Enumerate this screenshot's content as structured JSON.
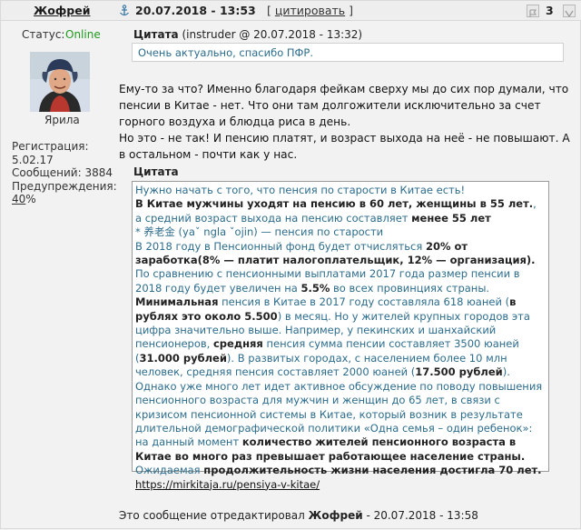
{
  "header": {
    "author": "Жофрей",
    "date": "20.07.2018 - 13:53",
    "quote_bracket_left": "[",
    "quote_link": "цитировать",
    "quote_bracket_right": "]",
    "rep_count": "3"
  },
  "sidebar": {
    "status_label": "Статус:",
    "status_value": "Online",
    "user_title": "Ярила",
    "reg_label": "Регистрация:",
    "reg_value": "5.02.17",
    "posts_label": "Сообщений:",
    "posts_value": "3884",
    "warnings_label": "Предупреждения:",
    "warnings_value": "40",
    "warnings_suffix": "%"
  },
  "quote1": {
    "title": "Цитата",
    "meta": "(instruder @ 20.07.2018 - 13:32)",
    "text": "Очень актуально, спасибо ПФР."
  },
  "reply": {
    "p1": "Ему-то за что? Именно благодаря фейкам сверху мы до сих пор думали, что пенсии в Китае - нет. Что они там долгожители исключительно за счет горного воздуха и блюдца риса в день.",
    "p2": "Но это - не так! И пенсию платят, и возраст выхода на неё - не повышают. А в остальном - почти как у нас."
  },
  "quote2": {
    "title": "Цитата",
    "l1": "Нужно начать с того, что пенсия по старости в Китае есть!",
    "l2_bold": "В Китае мужчины уходят на пенсию в 60 лет, женщины в 55 лет.",
    "l2_rest": ", а средний возраст выхода на пенсию составляет",
    "l2_bold2": "менее 55 лет",
    "l3": "* 养老金 (yaˇ ngla ˇojin) — пенсия по старости",
    "l4_a": "В 2018 году в Пенсионный фонд будет отчисляться",
    "l4_b": "20% от заработка(8% — платит налогоплательщик, 12% — организация).",
    "l5_a": "По сравнению с пенсионными выплатами 2017 года размер пенсии в 2018 году будет увеличен на",
    "l5_b": "5.5%",
    "l5_c": "во всех провинциях страны.",
    "l6_a": "Минимальная",
    "l6_b": "пенсия в Китае в 2017 году составляла 618 юаней (",
    "l6_c": "в рублях это около 5.500",
    "l6_d": ") в месяц. Но у жителей крупных городов эта цифра значительно выше. Например, у пекинских и шанхайский пенсионеров,",
    "l6_e": "средняя",
    "l6_f": "пенсия сумма пенсии составляет 3500 юаней (",
    "l6_g": "31.000 рублей",
    "l6_h": "). В развитых городах, с населением более 10 млн человек, средняя пенсия составляет 2000 юаней (",
    "l6_i": "17.500 рублей",
    "l6_j": ").",
    "l7_a": "Однако уже много лет идет активное обсуждение по поводу повышения пенсионного возраста для мужчин и женщин до 65 лет, в связи с кризисом пенсионной системы в Китае, который возник в результате длительной демографической политики «Одна семья – один ребенок»: на данный момент",
    "l7_b": "количество жителей пенсионного возраста в Китае во много раз превышает работающее население страны.",
    "l8_a": "Ожидаемая",
    "l8_b": "продолжительность жизни населения достигла 70 лет.",
    "link": "https://mirkitaja.ru/pensiya-v-kitae/"
  },
  "edit_note": {
    "prefix": "Это сообщение отредактировал",
    "author": "Жофрей",
    "suffix": "- 20.07.2018 - 13:58"
  }
}
